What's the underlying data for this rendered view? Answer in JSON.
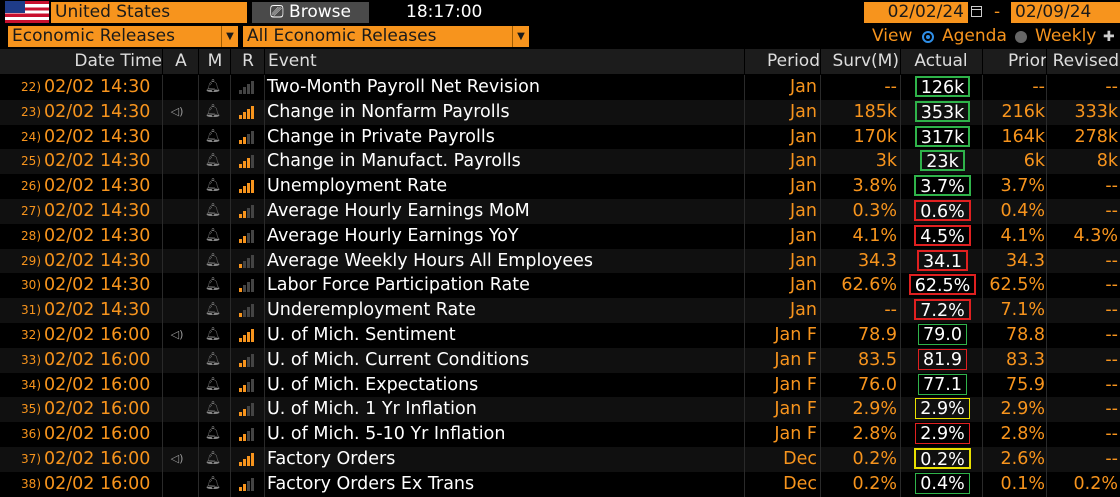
{
  "toolbar": {
    "country": "United States",
    "browse_label": "Browse",
    "clock": "18:17:00",
    "date_from": "02/02/24",
    "dash": "-",
    "date_to": "02/09/24",
    "browse_icon": "browse-icon",
    "calendar_icon": "calendar-icon"
  },
  "filters": {
    "category": "Economic Releases",
    "subcategory": "All Economic Releases",
    "view_label": "View",
    "view_options": [
      "Agenda",
      "Weekly"
    ],
    "view_selected": "Agenda"
  },
  "columns": {
    "date_time": "Date Time",
    "a": "A",
    "m": "M",
    "r": "R",
    "event": "Event",
    "period": "Period",
    "surv": "Surv(M)",
    "actual": "Actual",
    "prior": "Prior",
    "revised": "Revised"
  },
  "colors": {
    "accent": "#f7941d",
    "beat": "#2fb34a",
    "miss": "#e02020",
    "inline": "#e8e000"
  },
  "rows": [
    {
      "num": "22)",
      "dt": "02/02 14:30",
      "speaker": false,
      "bars": 0,
      "event": "Two-Month Payroll Net Revision",
      "period": "Jan",
      "surv": "--",
      "actual": "126k",
      "box": "b-g",
      "prior": "--",
      "revised": "--"
    },
    {
      "num": "23)",
      "dt": "02/02 14:30",
      "speaker": true,
      "bars": 4,
      "event": "Change in Nonfarm Payrolls",
      "period": "Jan",
      "surv": "185k",
      "actual": "353k",
      "box": "b-g",
      "prior": "216k",
      "revised": "333k"
    },
    {
      "num": "24)",
      "dt": "02/02 14:30",
      "speaker": false,
      "bars": 2,
      "event": "Change in Private Payrolls",
      "period": "Jan",
      "surv": "170k",
      "actual": "317k",
      "box": "b-g",
      "prior": "164k",
      "revised": "278k"
    },
    {
      "num": "25)",
      "dt": "02/02 14:30",
      "speaker": false,
      "bars": 3,
      "event": "Change in Manufact. Payrolls",
      "period": "Jan",
      "surv": "3k",
      "actual": "23k",
      "box": "b-g",
      "prior": "6k",
      "revised": "8k"
    },
    {
      "num": "26)",
      "dt": "02/02 14:30",
      "speaker": false,
      "bars": 4,
      "event": "Unemployment Rate",
      "period": "Jan",
      "surv": "3.8%",
      "actual": "3.7%",
      "box": "b-g",
      "prior": "3.7%",
      "revised": "--"
    },
    {
      "num": "27)",
      "dt": "02/02 14:30",
      "speaker": false,
      "bars": 2,
      "event": "Average Hourly Earnings MoM",
      "period": "Jan",
      "surv": "0.3%",
      "actual": "0.6%",
      "box": "b-r",
      "prior": "0.4%",
      "revised": "--"
    },
    {
      "num": "28)",
      "dt": "02/02 14:30",
      "speaker": false,
      "bars": 2,
      "event": "Average Hourly Earnings YoY",
      "period": "Jan",
      "surv": "4.1%",
      "actual": "4.5%",
      "box": "b-r",
      "prior": "4.1%",
      "revised": "4.3%"
    },
    {
      "num": "29)",
      "dt": "02/02 14:30",
      "speaker": false,
      "bars": 1,
      "event": "Average Weekly Hours All Employees",
      "period": "Jan",
      "surv": "34.3",
      "actual": "34.1",
      "box": "b-r",
      "prior": "34.3",
      "revised": "--"
    },
    {
      "num": "30)",
      "dt": "02/02 14:30",
      "speaker": false,
      "bars": 1,
      "event": "Labor Force Participation Rate",
      "period": "Jan",
      "surv": "62.6%",
      "actual": "62.5%",
      "box": "b-r",
      "prior": "62.5%",
      "revised": "--"
    },
    {
      "num": "31)",
      "dt": "02/02 14:30",
      "speaker": false,
      "bars": 1,
      "event": "Underemployment Rate",
      "period": "Jan",
      "surv": "--",
      "actual": "7.2%",
      "box": "b-r",
      "prior": "7.1%",
      "revised": "--"
    },
    {
      "num": "32)",
      "dt": "02/02 16:00",
      "speaker": true,
      "bars": 4,
      "event": "U. of Mich. Sentiment",
      "period": "Jan F",
      "surv": "78.9",
      "actual": "79.0",
      "box": "b-gt",
      "prior": "78.8",
      "revised": "--"
    },
    {
      "num": "33)",
      "dt": "02/02 16:00",
      "speaker": false,
      "bars": 2,
      "event": "U. of Mich. Current Conditions",
      "period": "Jan F",
      "surv": "83.5",
      "actual": "81.9",
      "box": "b-rt",
      "prior": "83.3",
      "revised": "--"
    },
    {
      "num": "34)",
      "dt": "02/02 16:00",
      "speaker": false,
      "bars": 2,
      "event": "U. of Mich. Expectations",
      "period": "Jan F",
      "surv": "76.0",
      "actual": "77.1",
      "box": "b-gt",
      "prior": "75.9",
      "revised": "--"
    },
    {
      "num": "35)",
      "dt": "02/02 16:00",
      "speaker": false,
      "bars": 2,
      "event": "U. of Mich. 1 Yr Inflation",
      "period": "Jan F",
      "surv": "2.9%",
      "actual": "2.9%",
      "box": "b-yt",
      "prior": "2.9%",
      "revised": "--"
    },
    {
      "num": "36)",
      "dt": "02/02 16:00",
      "speaker": false,
      "bars": 2,
      "event": "U. of Mich. 5-10 Yr Inflation",
      "period": "Jan F",
      "surv": "2.8%",
      "actual": "2.9%",
      "box": "b-rt",
      "prior": "2.8%",
      "revised": "--"
    },
    {
      "num": "37)",
      "dt": "02/02 16:00",
      "speaker": true,
      "bars": 4,
      "event": "Factory Orders",
      "period": "Dec",
      "surv": "0.2%",
      "actual": "0.2%",
      "box": "b-y",
      "prior": "2.6%",
      "revised": "--"
    },
    {
      "num": "38)",
      "dt": "02/02 16:00",
      "speaker": false,
      "bars": 2,
      "event": "Factory Orders Ex Trans",
      "period": "Dec",
      "surv": "0.2%",
      "actual": "0.4%",
      "box": "b-gt",
      "prior": "0.1%",
      "revised": "0.2%"
    }
  ]
}
